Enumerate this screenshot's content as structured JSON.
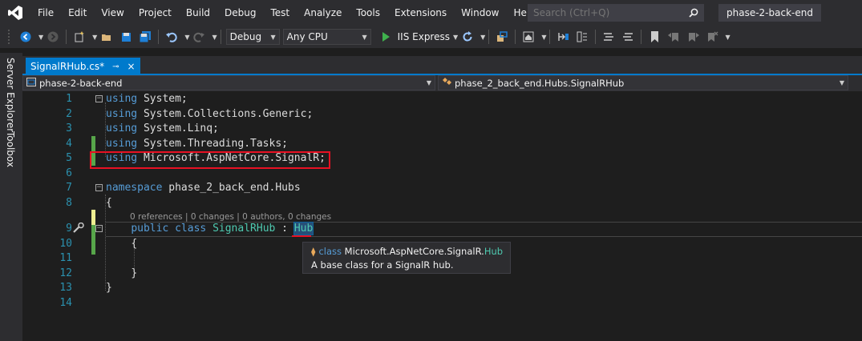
{
  "menu": {
    "items": [
      "File",
      "Edit",
      "View",
      "Project",
      "Build",
      "Debug",
      "Test",
      "Analyze",
      "Tools",
      "Extensions",
      "Window",
      "Help"
    ],
    "search_placeholder": "Search (Ctrl+Q)",
    "solution_name": "phase-2-back-end"
  },
  "toolbar": {
    "config": "Debug",
    "platform": "Any CPU",
    "run_target": "IIS Express"
  },
  "side_tabs": [
    "Server Explorer",
    "Toolbox"
  ],
  "doc_tab": {
    "title": "SignalRHub.cs*",
    "pin": "⊸",
    "close": "×"
  },
  "navbar": {
    "project": "phase-2-back-end",
    "type": "phase_2_back_end.Hubs.SignalRHub"
  },
  "editor": {
    "line_numbers": [
      "1",
      "2",
      "3",
      "4",
      "5",
      "6",
      "7",
      "8",
      "9",
      "10",
      "11",
      "12",
      "13",
      "14"
    ],
    "kw": {
      "using": "using",
      "namespace": "namespace",
      "public": "public",
      "class": "class"
    },
    "code": {
      "l1": " System;",
      "l2": " System.Collections.Generic;",
      "l3": " System.Linq;",
      "l4": " System.Threading.Tasks;",
      "l5": " Microsoft.AspNetCore.SignalR;",
      "l7": " phase_2_back_end.Hubs",
      "l8": "{",
      "l9_class_name": "SignalRHub",
      "l9_colon": " : ",
      "l9_base": "Hub",
      "l10": "{",
      "l12": "}",
      "l13": "}"
    },
    "codelens": "0 references | 0 changes | 0 authors, 0 changes"
  },
  "tooltip": {
    "kind": "class",
    "namespace": "Microsoft.AspNetCore.SignalR.",
    "type": "Hub",
    "description": "A base class for a SignalR hub."
  }
}
